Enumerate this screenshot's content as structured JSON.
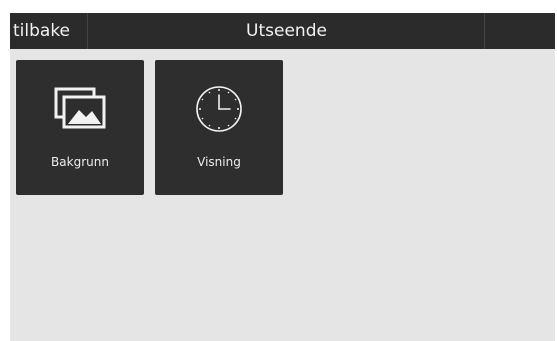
{
  "header": {
    "back_label": "tilbake",
    "title": "Utseende"
  },
  "tiles": [
    {
      "label": "Bakgrunn",
      "icon": "pictures-icon"
    },
    {
      "label": "Visning",
      "icon": "clock-icon"
    }
  ],
  "colors": {
    "topbar": "#2b2b2b",
    "background": "#e5e5e5",
    "tile": "#2e2e2e",
    "text": "#f2f2f2"
  }
}
